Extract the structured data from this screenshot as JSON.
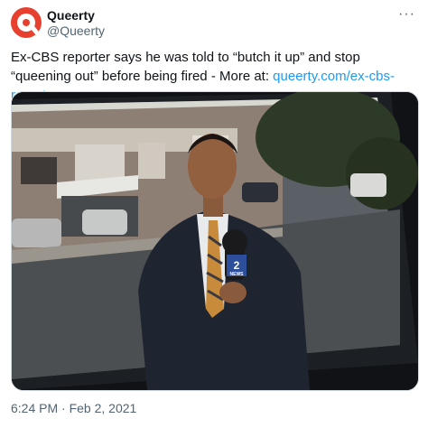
{
  "tweet": {
    "display_name": "Queerty",
    "handle": "@Queerty",
    "more_label": "···",
    "text_before_link": "Ex-CBS reporter says he was told to “butch it up” and stop “queening out” before being fired - More at: ",
    "link_text": "queerty.com/ex-cbs-reporte…",
    "timestamp": "6:24 PM · Feb 2, 2021"
  },
  "media": {
    "mic_flag_text": "2",
    "mic_flag_sub": "NEWS"
  },
  "colors": {
    "brand": "#e8402f",
    "link": "#1d9bf0",
    "secondary_text": "#536471"
  }
}
